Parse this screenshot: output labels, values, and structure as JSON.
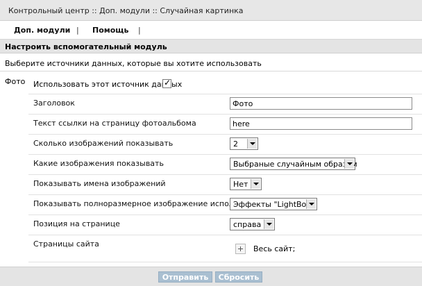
{
  "breadcrumb": "Контрольный центр :: Доп. модули :: Случайная картинка",
  "nav": {
    "items": [
      "Доп. модули",
      "Помощь"
    ],
    "separator": "|"
  },
  "section": {
    "title": "Настроить вспомогательный модуль",
    "intro": "Выберите источники данных, которые вы хотите использовать"
  },
  "group": {
    "label": "Фото",
    "use_source_label": "Использовать этот источник данных",
    "use_source_checked": true
  },
  "fields": {
    "title": {
      "label": "Заголовок",
      "value": "Фото"
    },
    "link_text": {
      "label": "Текст ссылки на страницу фотоальбома",
      "value": "here"
    },
    "count": {
      "label": "Сколько изображений показывать",
      "value": "2"
    },
    "which": {
      "label": "Какие изображения показывать",
      "value": "Выбраные случайным образом"
    },
    "show_names": {
      "label": "Показывать имена изображений",
      "value": "Нет"
    },
    "fullsize": {
      "label": "Показывать полноразмерное изображение используя",
      "value": "Эффекты \"LightBox\""
    },
    "position": {
      "label": "Позиция на странице",
      "value": "справа"
    },
    "pages": {
      "label": "Страницы сайта",
      "value": "Весь сайт;"
    }
  },
  "buttons": {
    "submit": "Отправить",
    "reset": "Сбросить"
  },
  "colors": {
    "header_bg": "#e7e7e7",
    "button_bg": "#a9bfd1",
    "button_text": "#ffffff"
  }
}
